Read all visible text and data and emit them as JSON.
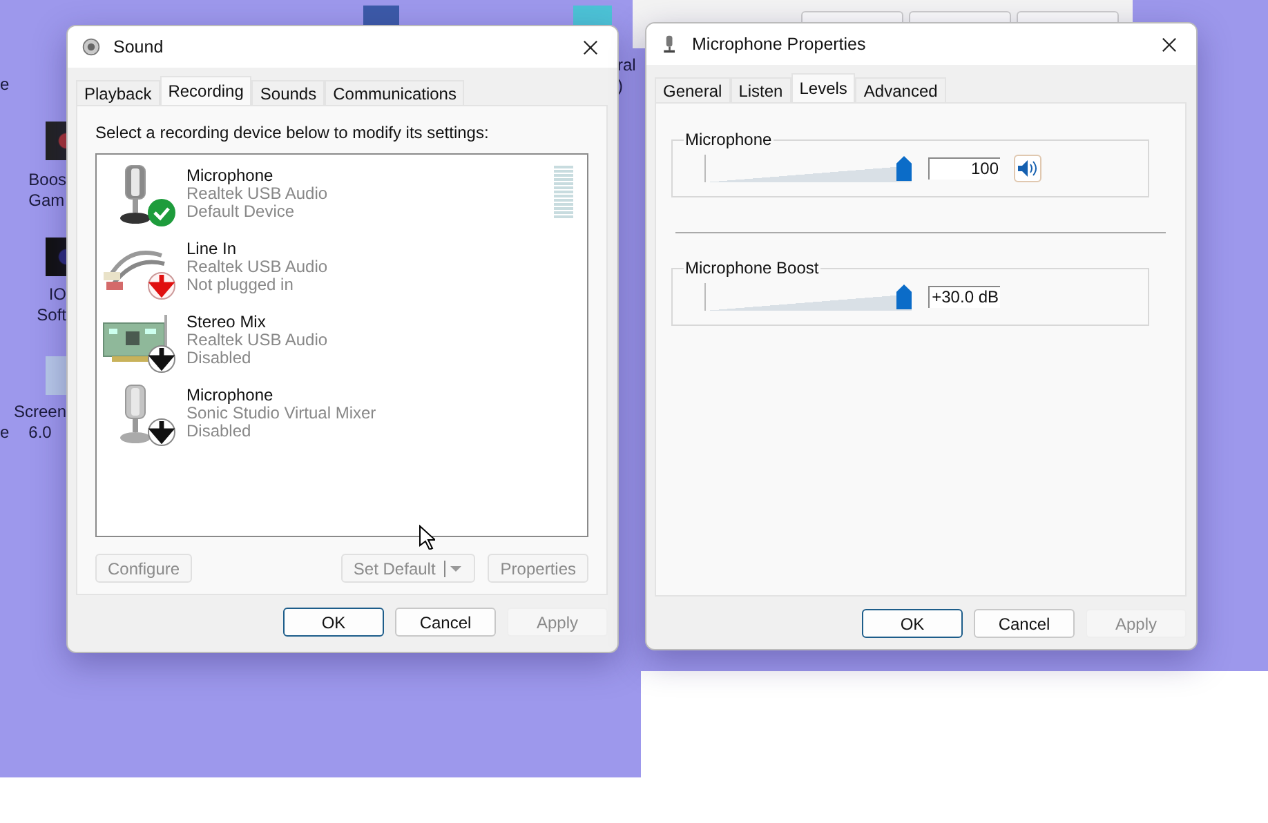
{
  "desktop": {
    "labels": [
      {
        "lines": [
          "e"
        ]
      },
      {
        "lines": [
          "Boos",
          "Gam"
        ]
      },
      {
        "lines": [
          "IO",
          "Soft"
        ]
      },
      {
        "lines": [
          "e"
        ]
      },
      {
        "lines": [
          "Screen",
          "6.0"
        ]
      },
      {
        "lines": [
          "ral",
          ")"
        ]
      }
    ]
  },
  "sound_window": {
    "title": "Sound",
    "tabs": [
      {
        "label": "Playback",
        "selected": false
      },
      {
        "label": "Recording",
        "selected": true
      },
      {
        "label": "Sounds",
        "selected": false
      },
      {
        "label": "Communications",
        "selected": false
      }
    ],
    "instruction": "Select a recording device below to modify its settings:",
    "devices": [
      {
        "kind": "mic",
        "name": "Microphone",
        "driver": "Realtek USB Audio",
        "status": "Default Device",
        "is_default": true,
        "level_meter": true
      },
      {
        "kind": "line-in",
        "name": "Line In",
        "driver": "Realtek USB Audio",
        "status": "Not plugged in",
        "is_default": false,
        "plugged_in": false,
        "level_meter": false
      },
      {
        "kind": "sound-card",
        "name": "Stereo Mix",
        "driver": "Realtek USB Audio",
        "status": "Disabled",
        "is_default": false,
        "plugged_in": true,
        "level_meter": false
      },
      {
        "kind": "mic",
        "name": "Microphone",
        "driver": "Sonic Studio Virtual Mixer",
        "status": "Disabled",
        "is_default": false,
        "plugged_in": true,
        "level_meter": false
      }
    ],
    "panel_buttons": [
      {
        "label": "Configure",
        "disabled": true,
        "split": false
      },
      {
        "label": "Set Default",
        "disabled": true,
        "split": true
      },
      {
        "label": "Properties",
        "disabled": true,
        "split": false
      }
    ],
    "buttons": [
      {
        "label": "OK",
        "disabled": false,
        "default": true
      },
      {
        "label": "Cancel",
        "disabled": false,
        "default": false
      },
      {
        "label": "Apply",
        "disabled": true,
        "default": false
      }
    ]
  },
  "properties_window": {
    "title": "Microphone Properties",
    "tabs": [
      {
        "label": "General",
        "selected": false
      },
      {
        "label": "Listen",
        "selected": false
      },
      {
        "label": "Levels",
        "selected": true
      },
      {
        "label": "Advanced",
        "selected": false
      }
    ],
    "levels": [
      {
        "label": "Microphone",
        "level": 1,
        "reading": "100",
        "mute_button": true,
        "muted": false
      },
      {
        "label": "Microphone Boost",
        "level": 1,
        "reading": "+30.0 dB",
        "mute_button": false
      }
    ],
    "buttons": [
      {
        "label": "OK",
        "disabled": false,
        "default": true
      },
      {
        "label": "Cancel",
        "disabled": false,
        "default": false
      },
      {
        "label": "Apply",
        "disabled": true,
        "default": false
      }
    ]
  }
}
